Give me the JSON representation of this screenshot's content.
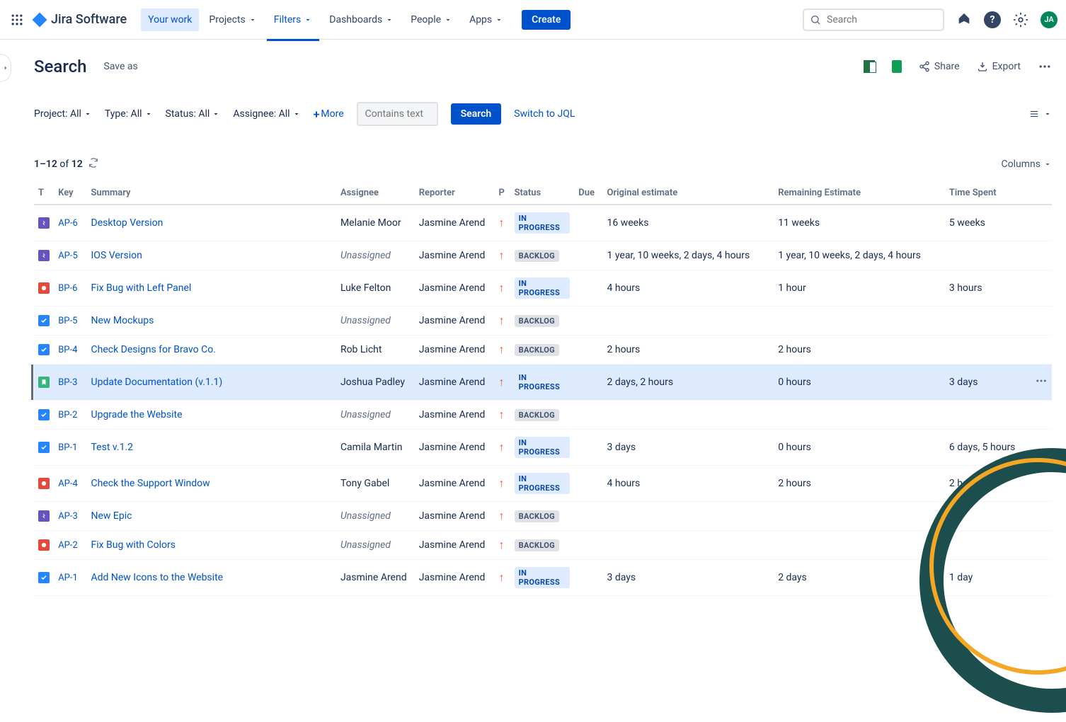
{
  "brand": "Jira Software",
  "nav": {
    "your_work": "Your work",
    "projects": "Projects",
    "filters": "Filters",
    "dashboards": "Dashboards",
    "people": "People",
    "apps": "Apps",
    "create": "Create"
  },
  "search_placeholder": "Search",
  "avatar_initials": "JA",
  "page": {
    "title": "Search",
    "save_as": "Save as",
    "share": "Share",
    "export": "Export"
  },
  "filters": {
    "project": "Project: All",
    "type": "Type: All",
    "status": "Status: All",
    "assignee": "Assignee: All",
    "more": "More",
    "contains_placeholder": "Contains text",
    "search_btn": "Search",
    "jql": "Switch to JQL"
  },
  "results": {
    "range": "1–12",
    "of": "of",
    "total": "12",
    "columns": "Columns"
  },
  "headers": {
    "t": "T",
    "key": "Key",
    "summary": "Summary",
    "assignee": "Assignee",
    "reporter": "Reporter",
    "p": "P",
    "status": "Status",
    "due": "Due",
    "original": "Original estimate",
    "remaining": "Remaining Estimate",
    "spent": "Time Spent"
  },
  "rows": [
    {
      "type": "epic",
      "key": "AP-6",
      "summary": "Desktop Version",
      "assignee": "Melanie Moor",
      "reporter": "Jasmine Arend",
      "priority": "up",
      "status": "IN PROGRESS",
      "statusClass": "inprogress",
      "orig": "16 weeks",
      "remain": "11 weeks",
      "spent": "5 weeks",
      "highlighted": false
    },
    {
      "type": "epic",
      "key": "AP-5",
      "summary": "IOS Version",
      "assignee": "Unassigned",
      "unassigned": true,
      "reporter": "Jasmine Arend",
      "priority": "up",
      "status": "BACKLOG",
      "statusClass": "backlog",
      "orig": "1 year, 10 weeks, 2 days, 4 hours",
      "remain": "1 year, 10 weeks, 2 days, 4 hours",
      "spent": "",
      "highlighted": false
    },
    {
      "type": "bug",
      "key": "BP-6",
      "summary": "Fix Bug with Left Panel",
      "assignee": "Luke Felton",
      "reporter": "Jasmine Arend",
      "priority": "up",
      "status": "IN PROGRESS",
      "statusClass": "inprogress",
      "orig": "4 hours",
      "remain": "1 hour",
      "spent": "3 hours",
      "highlighted": false
    },
    {
      "type": "task",
      "key": "BP-5",
      "summary": "New Mockups",
      "assignee": "Unassigned",
      "unassigned": true,
      "reporter": "Jasmine Arend",
      "priority": "up",
      "status": "BACKLOG",
      "statusClass": "backlog",
      "orig": "",
      "remain": "",
      "spent": "",
      "highlighted": false
    },
    {
      "type": "task",
      "key": "BP-4",
      "summary": "Check Designs for Bravo Co.",
      "assignee": "Rob Licht",
      "reporter": "Jasmine Arend",
      "priority": "up",
      "status": "BACKLOG",
      "statusClass": "backlog",
      "orig": "2 hours",
      "remain": "2 hours",
      "spent": "",
      "highlighted": false
    },
    {
      "type": "story",
      "key": "BP-3",
      "summary": "Update Documentation (v.1.1)",
      "assignee": "Joshua Padley",
      "reporter": "Jasmine Arend",
      "priority": "up",
      "status": "IN PROGRESS",
      "statusClass": "inprogress",
      "orig": "2 days, 2 hours",
      "remain": "0 hours",
      "spent": "3 days",
      "highlighted": true
    },
    {
      "type": "task",
      "key": "BP-2",
      "summary": "Upgrade the Website",
      "assignee": "Unassigned",
      "unassigned": true,
      "reporter": "Jasmine Arend",
      "priority": "up",
      "status": "BACKLOG",
      "statusClass": "backlog",
      "orig": "",
      "remain": "",
      "spent": "",
      "highlighted": false
    },
    {
      "type": "task",
      "key": "BP-1",
      "summary": "Test v.1.2",
      "assignee": "Camila Martin",
      "reporter": "Jasmine Arend",
      "priority": "up",
      "status": "IN PROGRESS",
      "statusClass": "inprogress",
      "orig": "3 days",
      "remain": "0 hours",
      "spent": "6 days, 5 hours",
      "highlighted": false
    },
    {
      "type": "bug",
      "key": "AP-4",
      "summary": "Check the Support Window",
      "assignee": "Tony Gabel",
      "reporter": "Jasmine Arend",
      "priority": "up",
      "status": "IN PROGRESS",
      "statusClass": "inprogress",
      "orig": "4 hours",
      "remain": "2 hours",
      "spent": "2 hours",
      "highlighted": false
    },
    {
      "type": "epic",
      "key": "AP-3",
      "summary": "New Epic",
      "assignee": "Unassigned",
      "unassigned": true,
      "reporter": "Jasmine Arend",
      "priority": "up",
      "status": "BACKLOG",
      "statusClass": "backlog",
      "orig": "",
      "remain": "",
      "spent": "",
      "highlighted": false
    },
    {
      "type": "bug",
      "key": "AP-2",
      "summary": "Fix Bug with Colors",
      "assignee": "Unassigned",
      "unassigned": true,
      "reporter": "Jasmine Arend",
      "priority": "up",
      "status": "BACKLOG",
      "statusClass": "backlog",
      "orig": "",
      "remain": "",
      "spent": "",
      "highlighted": false
    },
    {
      "type": "task",
      "key": "AP-1",
      "summary": "Add New Icons to the Website",
      "assignee": "Jasmine Arend",
      "reporter": "Jasmine Arend",
      "priority": "up",
      "status": "IN PROGRESS",
      "statusClass": "inprogress",
      "orig": "3 days",
      "remain": "2 days",
      "spent": "1 day",
      "highlighted": false
    }
  ]
}
